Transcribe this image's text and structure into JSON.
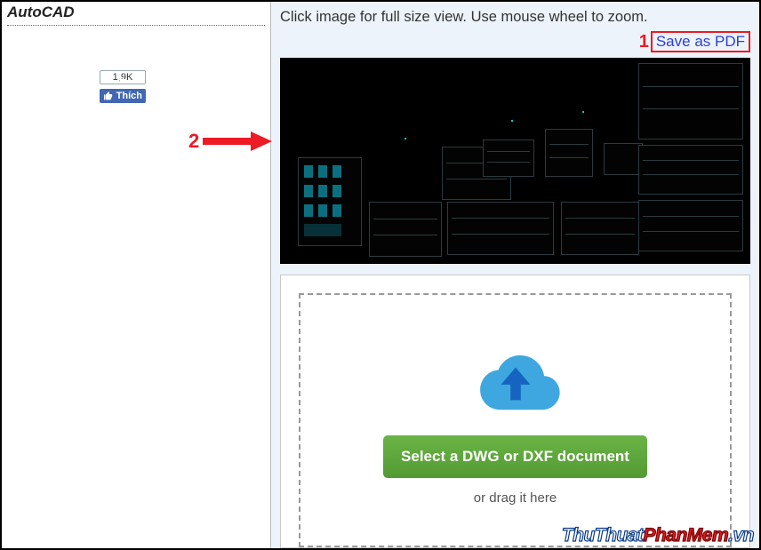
{
  "sidebar": {
    "title": "AutoCAD",
    "fb": {
      "count": "1,9K",
      "like_label": "Thích"
    }
  },
  "annotations": {
    "marker1": "1",
    "marker2": "2"
  },
  "main": {
    "hint": "Click image for full size view. Use mouse wheel to zoom.",
    "save_pdf_label": "Save as PDF"
  },
  "upload": {
    "button_label": "Select a DWG or DXF document",
    "drag_hint": "or drag it here"
  },
  "watermark": {
    "part1": "ThuThuat",
    "part2": "PhanMem",
    "part3": ".vn"
  }
}
